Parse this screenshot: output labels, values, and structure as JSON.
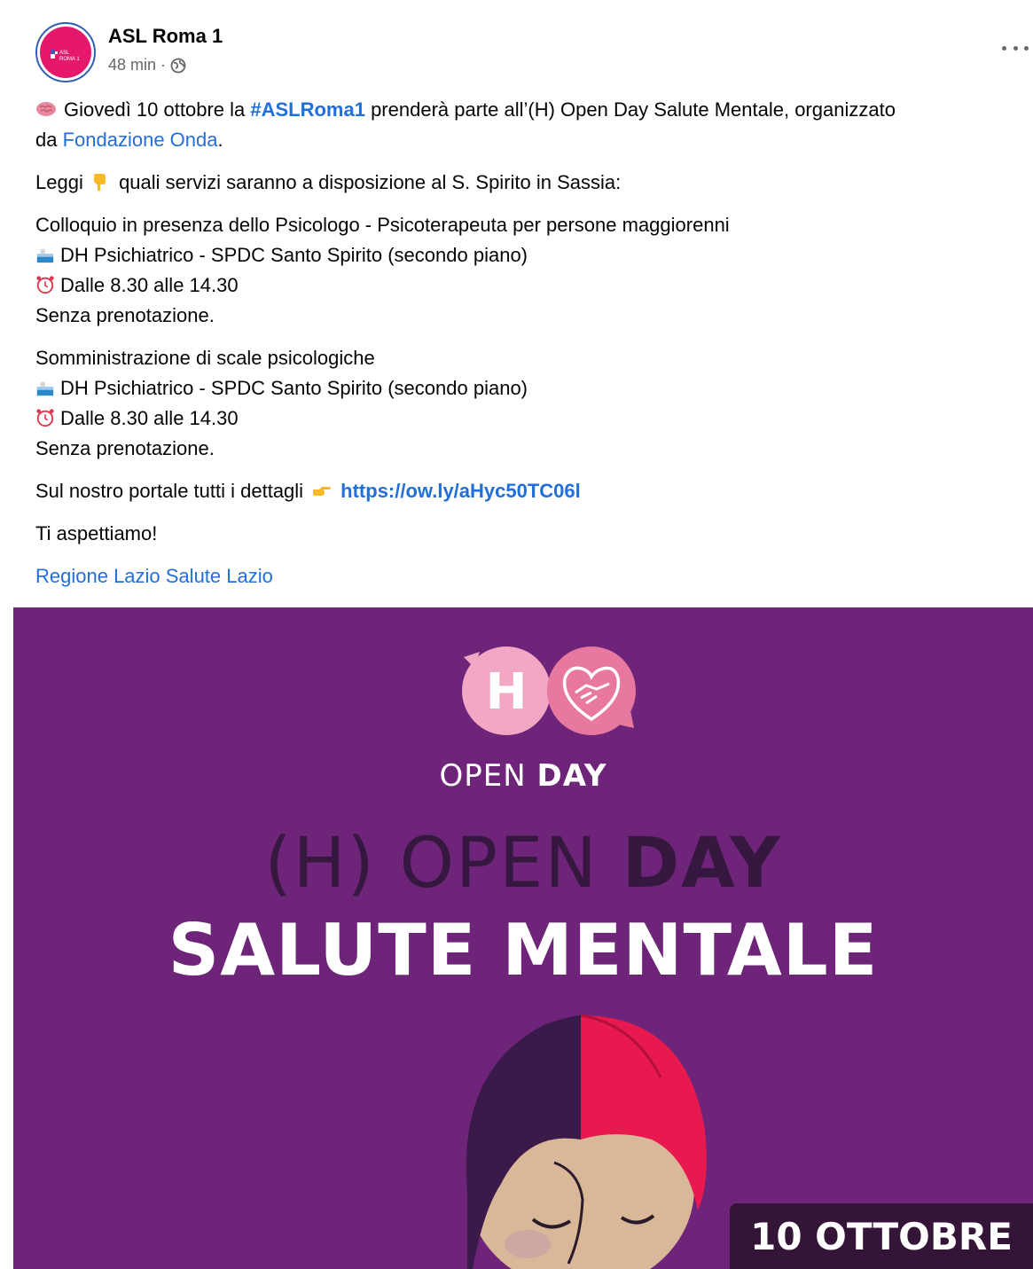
{
  "header": {
    "page_name": "ASL Roma 1",
    "time": "48 min",
    "separator": "·",
    "avatar_text": "ASL ROMA 1"
  },
  "post": {
    "intro": {
      "part1": "Giovedì 10 ottobre la ",
      "hashtag": "#ASLRoma1",
      "part2": " prenderà parte all’(H) Open Day Salute Mentale, organizzato",
      "part3": "da ",
      "link": "Fondazione Onda",
      "part4": "."
    },
    "leggi": {
      "before": "Leggi ",
      "after": " quali servizi saranno a disposizione al S. Spirito in Sassia:"
    },
    "service1": {
      "title": "Colloquio in presenza dello Psicologo - Psicoterapeuta per persone maggiorenni",
      "location": "DH Psichiatrico - SPDC Santo Spirito (secondo piano)",
      "hours": "Dalle 8.30 alle 14.30",
      "note": "Senza prenotazione."
    },
    "service2": {
      "title": "Somministrazione di scale psicologiche",
      "location": "DH Psichiatrico - SPDC Santo Spirito (secondo piano)",
      "hours": "Dalle 8.30 alle 14.30",
      "note": "Senza prenotazione."
    },
    "portal": {
      "text": "Sul nostro portale tutti i dettagli ",
      "url": "https://ow.ly/aHyc50TC06l"
    },
    "closing": "Ti aspettiamo!",
    "mentions": "Regione Lazio Salute Lazio"
  },
  "image": {
    "bubble_letter": "H",
    "open": "OPEN ",
    "day": "DAY",
    "headline_thin": "(H) OPEN ",
    "headline_bold": "DAY",
    "headline_2": "SALUTE MENTALE",
    "date": "10 OTTOBRE",
    "colors": {
      "background": "#6e2478",
      "bubble_light": "#f2a7c4",
      "bubble_dark": "#e8789f",
      "headline_dark": "#36173f",
      "hair_dark": "#3a1a4a",
      "hair_red": "#e8194f",
      "skin": "#d9b89a"
    }
  },
  "icons": {
    "brain": "brain-emoji-icon",
    "point_down": "backhand-index-pointing-down-icon",
    "hospital": "hospital-icon",
    "clock": "alarm-clock-icon",
    "point_right": "backhand-index-pointing-right-icon",
    "globe": "globe-icon",
    "more": "more-options-icon"
  }
}
